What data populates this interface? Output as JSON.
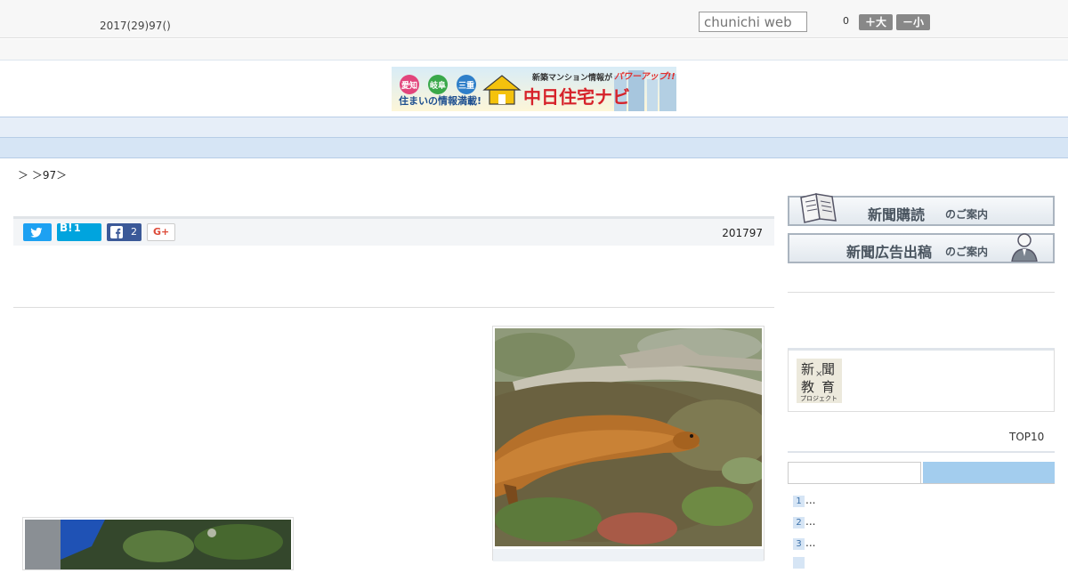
{
  "header": {
    "date": "2017(29)97()",
    "search_placeholder": "chunichi web",
    "font_size_count": "0",
    "font_larger_label": "＋大",
    "font_smaller_label": "－小"
  },
  "banner": {
    "regions": [
      "愛知",
      "岐阜",
      "三重"
    ],
    "tagline": "住まいの情報満載!",
    "headline": "新築マンション情報が",
    "power_up": "パワーアップ!!",
    "brand": "中日住宅ナビ"
  },
  "nav": {
    "items": [
      "",
      "",
      "",
      "",
      "",
      "",
      "",
      "",
      ""
    ]
  },
  "breadcrumb": "＞ ＞97＞",
  "share": {
    "hatena_label": "B!",
    "hatena_count": "1",
    "facebook_count": "2",
    "gplus_label": "G+",
    "published_date": "201797"
  },
  "sidebar": {
    "subscribe_main": "新聞購読",
    "subscribe_sub": "のご案内",
    "advertise_main": "新聞広告出稿",
    "advertise_sub": "のご案内",
    "edu_logo": {
      "chars": [
        "新",
        "聞",
        "教",
        "育"
      ],
      "cross": "×",
      "sub": "プロジェクト"
    },
    "top10_label": "TOP10",
    "ranking": [
      {
        "num": "1",
        "text": "..."
      },
      {
        "num": "2",
        "text": "..."
      },
      {
        "num": "3",
        "text": "..."
      },
      {
        "num": "",
        "text": ""
      }
    ]
  }
}
